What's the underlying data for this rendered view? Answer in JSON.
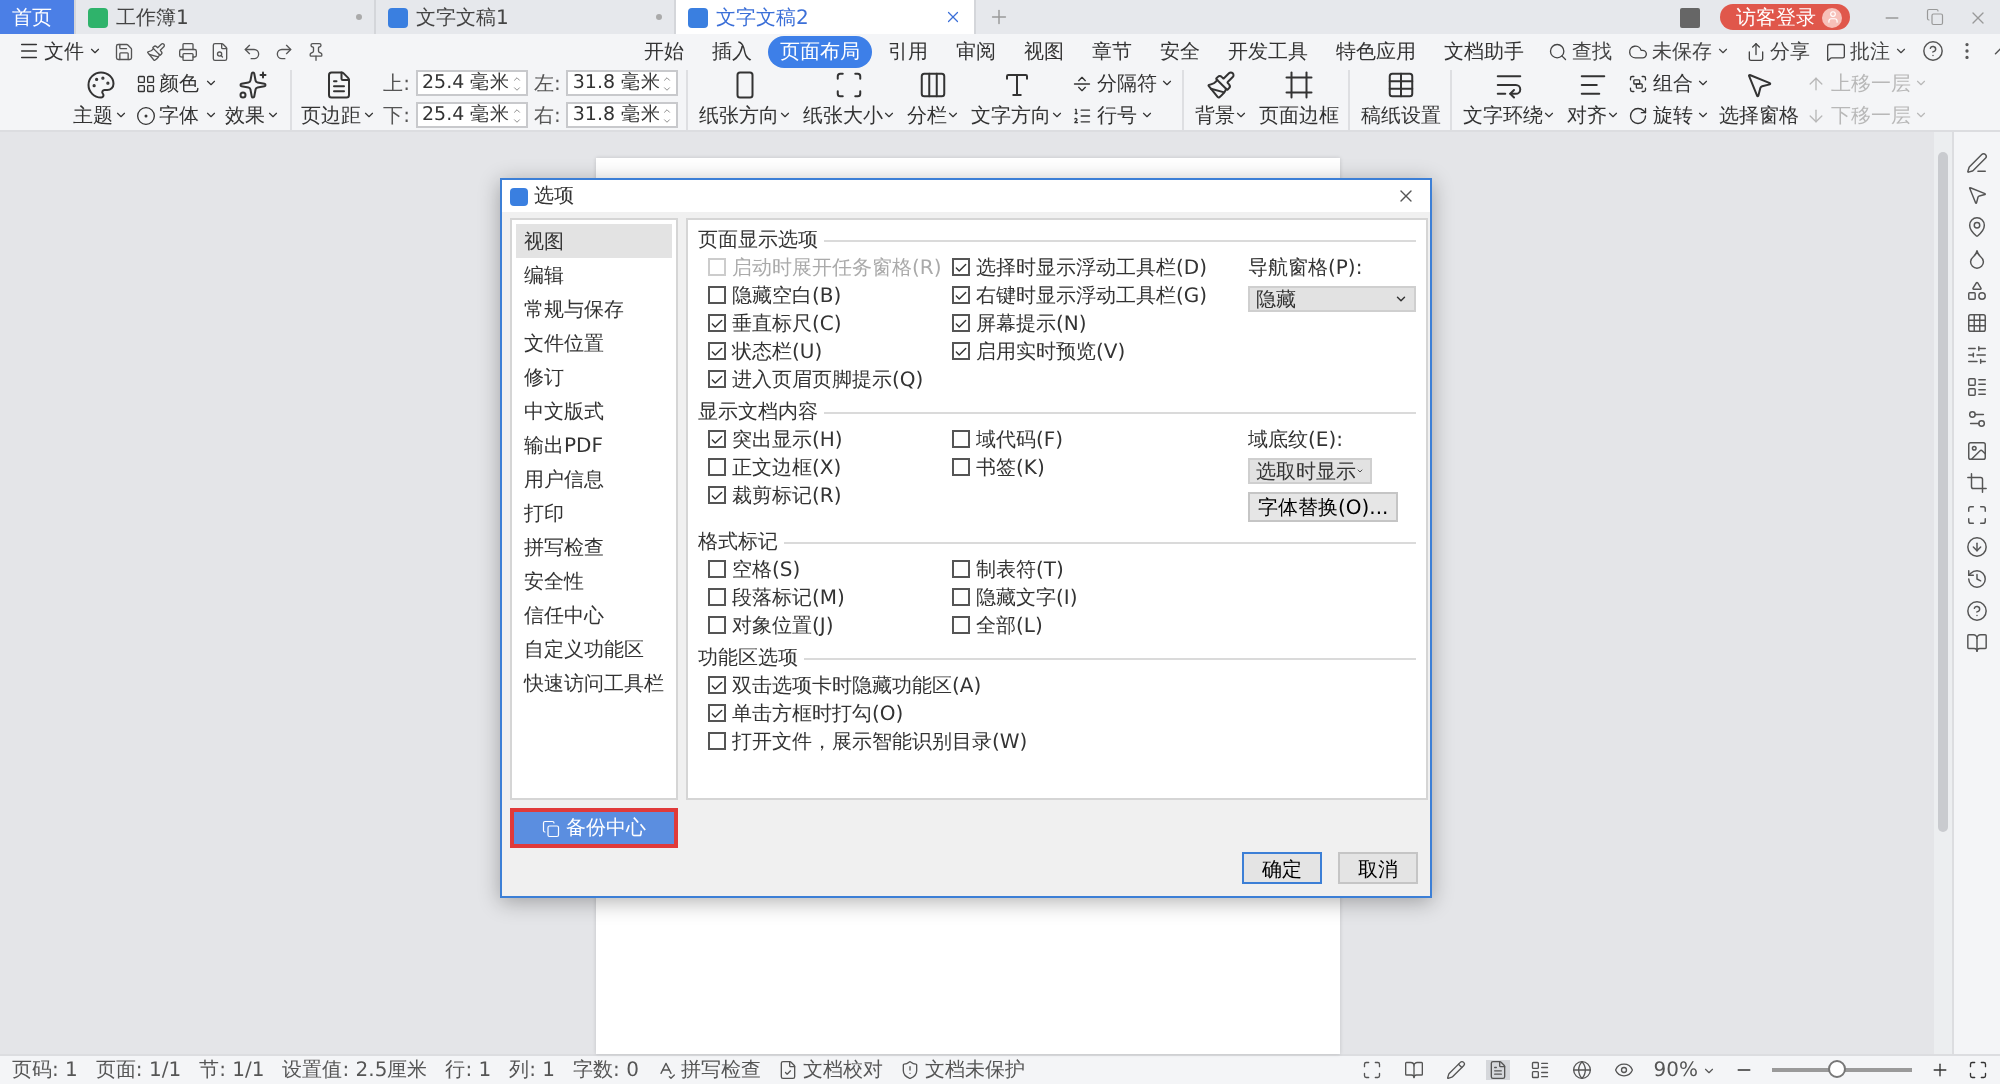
{
  "tabs": [
    {
      "label": "首页",
      "kind": "home",
      "selected": false
    },
    {
      "label": "工作簿1",
      "kind": "sheet",
      "selected": false
    },
    {
      "label": "文字文稿1",
      "kind": "doc",
      "selected": false
    },
    {
      "label": "文字文稿2",
      "kind": "doc",
      "selected": true
    }
  ],
  "login": "访客登录",
  "menu": {
    "file": "文件",
    "search": "查找",
    "tabs": [
      {
        "label": "开始",
        "selected": false
      },
      {
        "label": "插入",
        "selected": false
      },
      {
        "label": "页面布局",
        "selected": true
      },
      {
        "label": "引用",
        "selected": false
      },
      {
        "label": "审阅",
        "selected": false
      },
      {
        "label": "视图",
        "selected": false
      },
      {
        "label": "章节",
        "selected": false
      },
      {
        "label": "安全",
        "selected": false
      },
      {
        "label": "开发工具",
        "selected": false
      },
      {
        "label": "特色应用",
        "selected": false
      },
      {
        "label": "文档助手",
        "selected": false
      }
    ],
    "right": [
      "未保存",
      "分享",
      "批注"
    ]
  },
  "ribbon": [
    {
      "items": [
        {
          "kind": "large",
          "label": "主题",
          "dropdown": true
        },
        {
          "kind": "stack",
          "items": [
            {
              "label": "颜色",
              "dropdown": true,
              "disabled": false
            },
            {
              "label": "字体",
              "dropdown": true,
              "disabled": false
            }
          ]
        },
        {
          "kind": "large",
          "label": "效果",
          "dropdown": true
        }
      ]
    },
    {
      "items": [
        {
          "kind": "large",
          "label": "页边距",
          "dropdown": true
        },
        {
          "kind": "fields",
          "fields": [
            {
              "label": "上:",
              "value": "25.4 毫米"
            },
            {
              "label": "下:",
              "value": "25.4 毫米"
            },
            {
              "label": "左:",
              "value": "31.8 毫米"
            },
            {
              "label": "右:",
              "value": "31.8 毫米"
            }
          ]
        }
      ]
    },
    {
      "items": [
        {
          "kind": "large",
          "label": "纸张方向",
          "dropdown": true
        },
        {
          "kind": "large",
          "label": "纸张大小",
          "dropdown": true
        },
        {
          "kind": "large",
          "label": "分栏",
          "dropdown": true
        },
        {
          "kind": "large",
          "label": "文字方向",
          "dropdown": true
        },
        {
          "kind": "stack",
          "items": [
            {
              "label": "分隔符",
              "dropdown": true,
              "disabled": false
            },
            {
              "label": "行号",
              "dropdown": true,
              "disabled": false
            }
          ]
        }
      ]
    },
    {
      "items": [
        {
          "kind": "large",
          "label": "背景",
          "dropdown": true
        },
        {
          "kind": "large",
          "label": "页面边框",
          "dropdown": false
        }
      ]
    },
    {
      "items": [
        {
          "kind": "large",
          "label": "稿纸设置",
          "dropdown": false
        }
      ]
    },
    {
      "items": [
        {
          "kind": "large",
          "label": "文字环绕",
          "dropdown": true
        },
        {
          "kind": "large",
          "label": "对齐",
          "dropdown": true
        },
        {
          "kind": "stack",
          "items": [
            {
              "label": "组合",
              "dropdown": true,
              "disabled": false
            },
            {
              "label": "旋转",
              "dropdown": true,
              "disabled": false
            }
          ]
        },
        {
          "kind": "large",
          "label": "选择窗格",
          "dropdown": false
        },
        {
          "kind": "stack",
          "items": [
            {
              "label": "上移一层",
              "dropdown": true,
              "disabled": true
            },
            {
              "label": "下移一层",
              "dropdown": true,
              "disabled": true
            }
          ]
        }
      ]
    }
  ],
  "dialog": {
    "title": "选项",
    "nav": [
      {
        "label": "视图",
        "selected": true
      },
      {
        "label": "编辑",
        "selected": false
      },
      {
        "label": "常规与保存",
        "selected": false
      },
      {
        "label": "文件位置",
        "selected": false
      },
      {
        "label": "修订",
        "selected": false
      },
      {
        "label": "中文版式",
        "selected": false
      },
      {
        "label": "输出PDF",
        "selected": false
      },
      {
        "label": "用户信息",
        "selected": false
      },
      {
        "label": "打印",
        "selected": false
      },
      {
        "label": "拼写检查",
        "selected": false
      },
      {
        "label": "安全性",
        "selected": false
      },
      {
        "label": "信任中心",
        "selected": false
      },
      {
        "label": "自定义功能区",
        "selected": false
      },
      {
        "label": "快速访问工具栏",
        "selected": false
      }
    ],
    "backup": {
      "label": "备份中心",
      "highlighted": true
    },
    "sections": [
      {
        "title": "页面显示选项",
        "columns": [
          [
            {
              "label": "启动时展开任务窗格(R)",
              "checked": false,
              "disabled": true
            },
            {
              "label": "隐藏空白(B)",
              "checked": false,
              "disabled": false
            },
            {
              "label": "垂直标尺(C)",
              "checked": true,
              "disabled": false
            },
            {
              "label": "状态栏(U)",
              "checked": true,
              "disabled": false
            },
            {
              "label": "进入页眉页脚提示(Q)",
              "checked": true,
              "disabled": false
            }
          ],
          [
            {
              "label": "选择时显示浮动工具栏(D)",
              "checked": true,
              "disabled": false
            },
            {
              "label": "右键时显示浮动工具栏(G)",
              "checked": true,
              "disabled": false
            },
            {
              "label": "屏幕提示(N)",
              "checked": true,
              "disabled": false
            },
            {
              "label": "启用实时预览(V)",
              "checked": true,
              "disabled": false
            }
          ]
        ],
        "controls": [
          {
            "kind": "select",
            "label": "导航窗格(P):",
            "value": "隐藏",
            "wide": true
          }
        ]
      },
      {
        "title": "显示文档内容",
        "columns": [
          [
            {
              "label": "突出显示(H)",
              "checked": true,
              "disabled": false
            },
            {
              "label": "正文边框(X)",
              "checked": false,
              "disabled": false
            },
            {
              "label": "裁剪标记(R)",
              "checked": true,
              "disabled": false
            }
          ],
          [
            {
              "label": "域代码(F)",
              "checked": false,
              "disabled": false
            },
            {
              "label": "书签(K)",
              "checked": false,
              "disabled": false
            }
          ]
        ],
        "controls": [
          {
            "kind": "select",
            "label": "域底纹(E):",
            "value": "选取时显示",
            "wide": false
          },
          {
            "kind": "button",
            "label": "字体替换(O)..."
          }
        ]
      },
      {
        "title": "格式标记",
        "columns": [
          [
            {
              "label": "空格(S)",
              "checked": false,
              "disabled": false
            },
            {
              "label": "段落标记(M)",
              "checked": false,
              "disabled": false
            },
            {
              "label": "对象位置(J)",
              "checked": false,
              "disabled": false
            }
          ],
          [
            {
              "label": "制表符(T)",
              "checked": false,
              "disabled": false
            },
            {
              "label": "隐藏文字(I)",
              "checked": false,
              "disabled": false
            },
            {
              "label": "全部(L)",
              "checked": false,
              "disabled": false
            }
          ]
        ]
      },
      {
        "title": "功能区选项",
        "columns": [
          [
            {
              "label": "双击选项卡时隐藏功能区(A)",
              "checked": true,
              "disabled": false
            },
            {
              "label": "单击方框时打勾(O)",
              "checked": true,
              "disabled": false
            },
            {
              "label": "打开文件，展示智能识别目录(W)",
              "checked": false,
              "disabled": false
            }
          ]
        ]
      }
    ],
    "buttons": [
      {
        "label": "确定",
        "default": true
      },
      {
        "label": "取消",
        "default": false
      }
    ]
  },
  "status_bar": {
    "items": [
      "页码: 1",
      "页面: 1/1",
      "节: 1/1",
      "设置值: 2.5厘米",
      "行: 1",
      "列: 1",
      "字数: 0"
    ],
    "tools": [
      "拼写检查",
      "文档校对",
      "文档未保护"
    ],
    "zoom": "90%",
    "zoom_slider": {
      "level": 0.45
    }
  }
}
